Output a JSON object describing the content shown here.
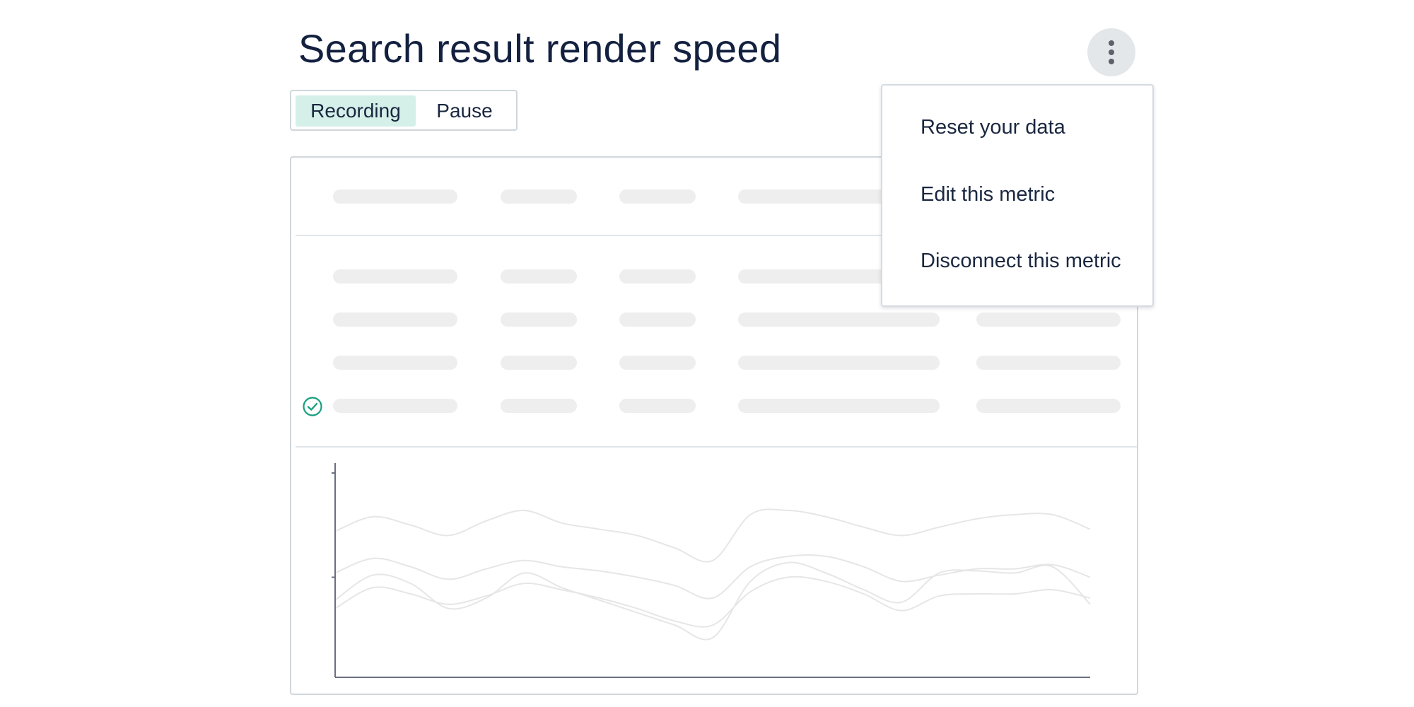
{
  "page": {
    "title": "Search result render speed"
  },
  "colors": {
    "title": "#13203f",
    "toggle_active_bg": "#d4f0e9",
    "skeleton": "#eeeeee",
    "check_icon": "#1a9e7e",
    "chart_line": "#e6e6e6",
    "axis": "#6b7080"
  },
  "toggle": {
    "options": [
      {
        "label": "Recording",
        "active": true
      },
      {
        "label": "Pause",
        "active": false
      }
    ]
  },
  "menu_button": {
    "icon": "kebab-vertical-icon"
  },
  "menu": {
    "items": [
      {
        "label": "Reset your data"
      },
      {
        "label": "Edit this metric"
      },
      {
        "label": "Disconnect this metric"
      }
    ]
  },
  "table_placeholder": {
    "header_rows": 1,
    "body_rows": 4,
    "checked_row": 4,
    "checked_icon": "check-circle-icon"
  },
  "chart_data": {
    "type": "line",
    "title": "",
    "xlabel": "",
    "ylabel": "",
    "grid": false,
    "x": [
      0,
      1,
      2,
      3,
      4,
      5,
      6,
      7,
      8,
      9,
      10,
      11,
      12,
      13,
      14,
      15,
      16,
      17,
      18,
      19,
      20
    ],
    "ylim": [
      0,
      100
    ],
    "series": [
      {
        "values": [
          70,
          77,
          73,
          68,
          75,
          80,
          74,
          71,
          68,
          62,
          56,
          78,
          80,
          77,
          72,
          68,
          72,
          76,
          78,
          78,
          71
        ]
      },
      {
        "values": [
          50,
          57,
          53,
          47,
          52,
          56,
          53,
          51,
          48,
          44,
          38,
          53,
          58,
          58,
          53,
          46,
          49,
          52,
          52,
          54,
          48
        ]
      },
      {
        "values": [
          37,
          49,
          45,
          33,
          38,
          50,
          43,
          37,
          31,
          25,
          19,
          46,
          55,
          50,
          42,
          36,
          50,
          51,
          50,
          53,
          35
        ]
      },
      {
        "values": [
          33,
          43,
          40,
          35,
          39,
          45,
          42,
          38,
          33,
          27,
          25,
          41,
          48,
          46,
          40,
          32,
          39,
          40,
          40,
          42,
          38
        ]
      }
    ]
  }
}
